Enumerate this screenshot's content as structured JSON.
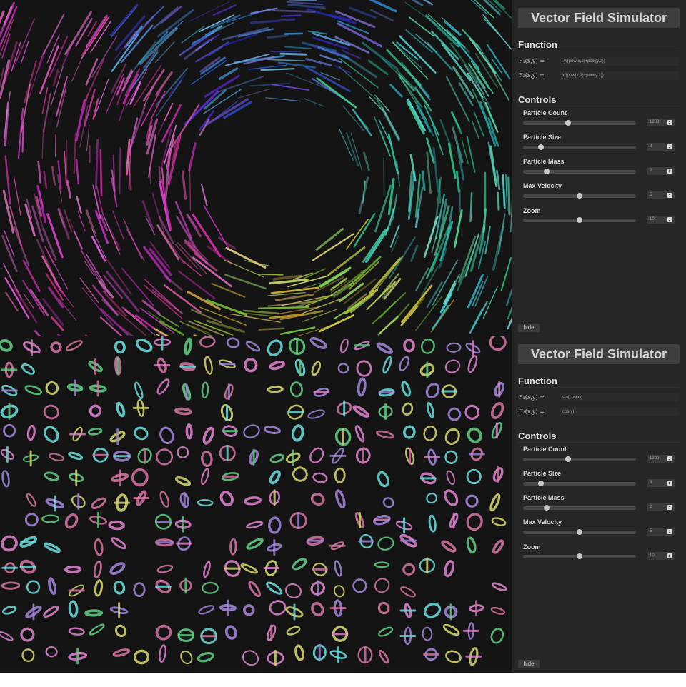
{
  "instances": [
    {
      "panel": {
        "title": "Vector Field Simulator",
        "function_heading": "Function",
        "f1_label": "F₁(x,y) =",
        "f1_value": "-y/(pow(x,2)+pow(y,2))",
        "f2_label": "F₂(x,y) =",
        "f2_value": "x/(pow(x,2)+pow(y,2))",
        "controls_heading": "Controls",
        "controls": [
          {
            "label": "Particle Count",
            "value": "1200",
            "level": 0.4
          },
          {
            "label": "Particle Size",
            "value": "8",
            "level": 0.16
          },
          {
            "label": "Particle Mass",
            "value": "2",
            "level": 0.21
          },
          {
            "label": "Max Velocity",
            "value": "5",
            "level": 0.5
          },
          {
            "label": "Zoom",
            "value": "10",
            "level": 0.5
          }
        ],
        "hide_label": "hide"
      },
      "canvas": {
        "pattern": "vortex-streaks"
      }
    },
    {
      "panel": {
        "title": "Vector Field Simulator",
        "function_heading": "Function",
        "f1_label": "F₁(x,y) =",
        "f1_value": "sin(cos(x))",
        "f2_label": "F₂(x,y) =",
        "f2_value": "cos(y)",
        "controls_heading": "Controls",
        "controls": [
          {
            "label": "Particle Count",
            "value": "1200",
            "level": 0.4
          },
          {
            "label": "Particle Size",
            "value": "8",
            "level": 0.16
          },
          {
            "label": "Particle Mass",
            "value": "2",
            "level": 0.21
          },
          {
            "label": "Max Velocity",
            "value": "5",
            "level": 0.5
          },
          {
            "label": "Zoom",
            "value": "10",
            "level": 0.5
          }
        ],
        "hide_label": "hide"
      },
      "canvas": {
        "pattern": "orbit-loops"
      }
    }
  ],
  "colors": {
    "canvas_bg": "#141414",
    "panel_bg": "#262626",
    "title_box": "#3f3f3f",
    "slider_track": "#484848",
    "slider_thumb": "#c9c9c9"
  }
}
